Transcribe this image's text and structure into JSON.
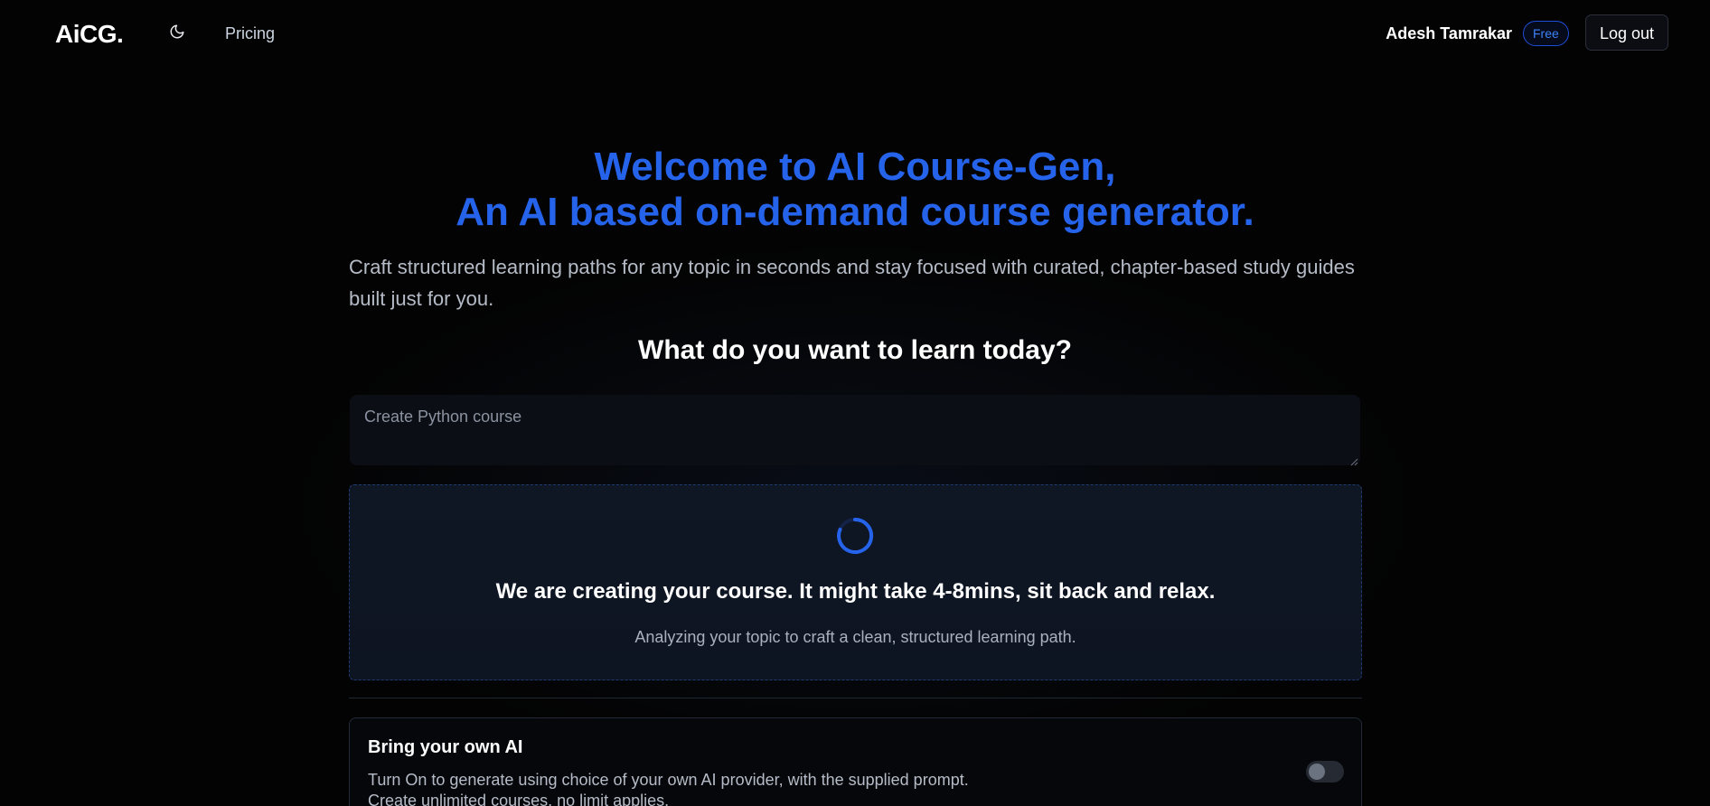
{
  "header": {
    "logo": "AiCG.",
    "theme_icon": "moon-icon",
    "nav_pricing": "Pricing",
    "user_name": "Adesh Tamrakar",
    "plan_badge": "Free",
    "logout_label": "Log out"
  },
  "hero": {
    "title_line1": "Welcome to AI Course-Gen,",
    "title_line2": "An AI based on-demand course generator.",
    "subtitle": "Craft structured learning paths for any topic in seconds and stay focused with curated, chapter-based study guides built just for you.",
    "question": "What do you want to learn today?"
  },
  "prompt": {
    "placeholder": "Create Python course",
    "value": ""
  },
  "loading": {
    "spinner_icon": "spinner-icon",
    "title": "We are creating your course. It might take 4-8mins, sit back and relax.",
    "subtitle": "Analyzing your topic to craft a clean, structured learning path."
  },
  "byo_ai": {
    "title": "Bring your own AI",
    "desc_line1": "Turn On to generate using choice of your own AI provider, with the supplied prompt.",
    "desc_line2": "Create unlimited courses, no limit applies.",
    "toggle_state": "off"
  },
  "colors": {
    "accent": "#2563eb",
    "background": "#030303",
    "badge_border": "#1d4ed8"
  }
}
